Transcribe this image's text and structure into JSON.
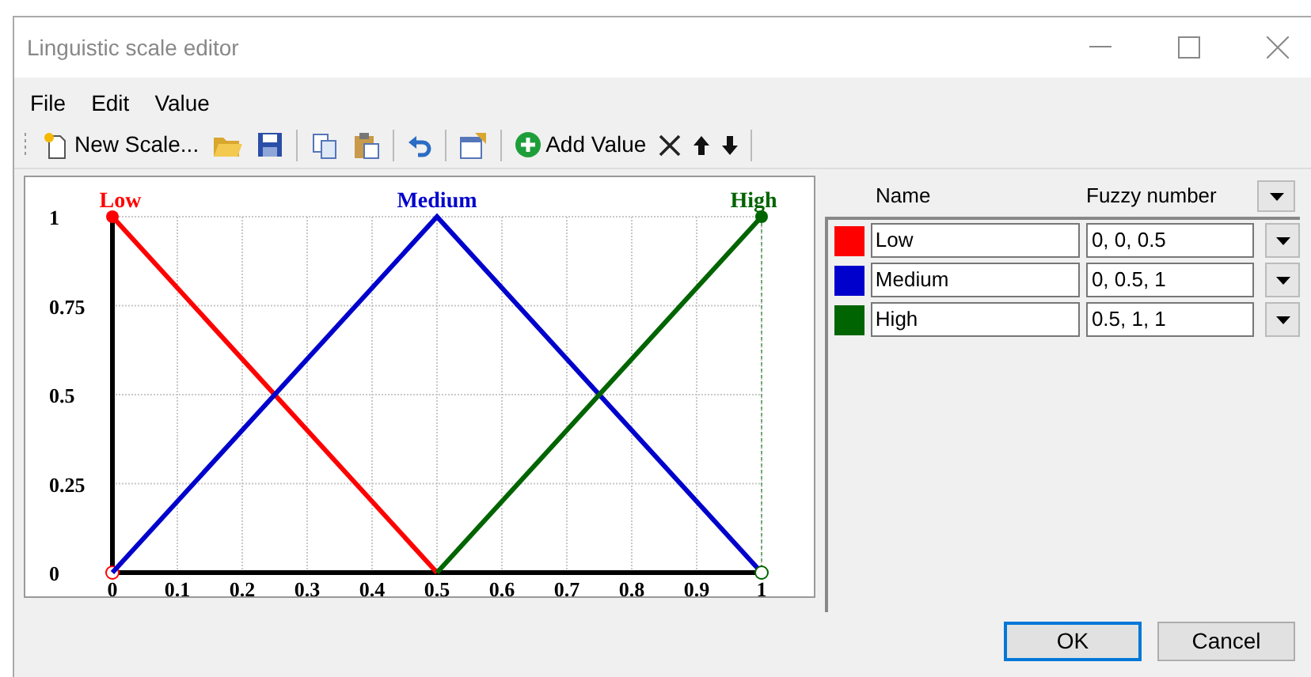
{
  "window": {
    "title": "Linguistic scale editor"
  },
  "menu": [
    "File",
    "Edit",
    "Value"
  ],
  "toolbar": [
    {
      "kind": "new",
      "label": "New Scale..."
    },
    {
      "kind": "open"
    },
    {
      "kind": "save"
    },
    {
      "kind": "separator"
    },
    {
      "kind": "copy"
    },
    {
      "kind": "paste"
    },
    {
      "kind": "separator"
    },
    {
      "kind": "undo"
    },
    {
      "kind": "separator"
    },
    {
      "kind": "properties"
    },
    {
      "kind": "separator"
    },
    {
      "kind": "add",
      "label": "Add Value"
    },
    {
      "kind": "delete"
    },
    {
      "kind": "up"
    },
    {
      "kind": "down"
    }
  ],
  "chart_data": {
    "type": "line",
    "grid": true,
    "x": [
      0,
      0.5,
      1
    ],
    "series": [
      {
        "name": "Low",
        "color": "#ff0000",
        "values": [
          1,
          0,
          null
        ]
      },
      {
        "name": "Medium",
        "color": "#0000cc",
        "values": [
          0,
          1,
          0
        ]
      },
      {
        "name": "High",
        "color": "#006400",
        "values": [
          null,
          0,
          1
        ]
      }
    ],
    "xlim": [
      0,
      1
    ],
    "ylim": [
      0,
      1
    ],
    "xticks": [
      0,
      0.1,
      0.2,
      0.3,
      0.4,
      0.5,
      0.6,
      0.7,
      0.8,
      0.9,
      1
    ],
    "yticks": [
      0,
      0.25,
      0.5,
      0.75,
      1
    ]
  },
  "table": {
    "columns": [
      "Name",
      "Fuzzy number"
    ],
    "rows": [
      {
        "color": "#ff0000",
        "name": "Low",
        "fuzzy": "0, 0, 0.5"
      },
      {
        "color": "#0000cc",
        "name": "Medium",
        "fuzzy": "0, 0.5, 1"
      },
      {
        "color": "#006400",
        "name": "High",
        "fuzzy": "0.5, 1, 1"
      }
    ]
  },
  "buttons": [
    {
      "label": "OK",
      "default": true
    },
    {
      "label": "Cancel",
      "default": false
    }
  ]
}
